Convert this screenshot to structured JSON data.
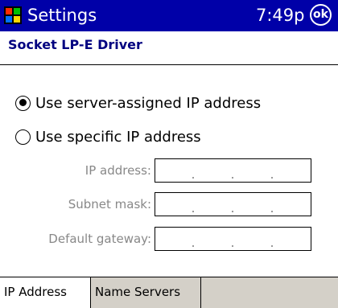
{
  "titlebar": {
    "app_title": "Settings",
    "clock": "7:49p",
    "ok_label": "ok"
  },
  "page": {
    "title": "Socket LP-E Driver"
  },
  "options": {
    "server_assigned_label": "Use server-assigned IP address",
    "specific_label": "Use specific IP address",
    "selected": "server_assigned"
  },
  "fields": {
    "ip_address_label": "IP address:",
    "subnet_mask_label": "Subnet mask:",
    "default_gateway_label": "Default gateway:"
  },
  "tabs": [
    {
      "label": "IP Address",
      "active": true
    },
    {
      "label": "Name Servers",
      "active": false
    }
  ],
  "colors": {
    "titlebar": "#0000a8",
    "page_title": "#000080",
    "disabled_text": "#888888",
    "tab_bar": "#d4d0c8"
  }
}
